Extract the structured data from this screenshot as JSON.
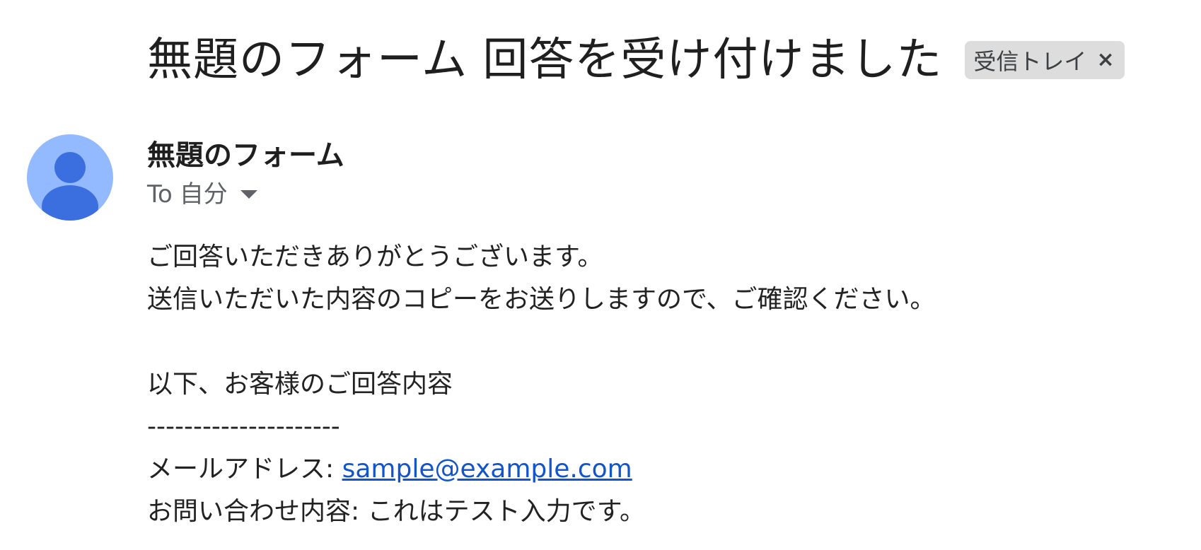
{
  "email": {
    "subject": "無題のフォーム 回答を受け付けました",
    "label_chip": {
      "text": "受信トレイ",
      "close_symbol": "×"
    },
    "avatar": {
      "icon": "person-icon",
      "background": "#93b9ff",
      "foreground": "#3b6fe0"
    },
    "sender_name": "無題のフォーム",
    "recipient": {
      "to_label": "To",
      "name": "自分"
    },
    "body": {
      "line1": "ご回答いただきありがとうございます。",
      "line2": "送信いただいた内容のコピーをお送りしますので、ご確認ください。",
      "line3": "以下、お客様のご回答内容",
      "separator": "---------------------",
      "email_label": "メールアドレス: ",
      "email_value": "sample@example.com",
      "inquiry_label": "お問い合わせ内容: ",
      "inquiry_value": "これはテスト入力です。"
    }
  }
}
